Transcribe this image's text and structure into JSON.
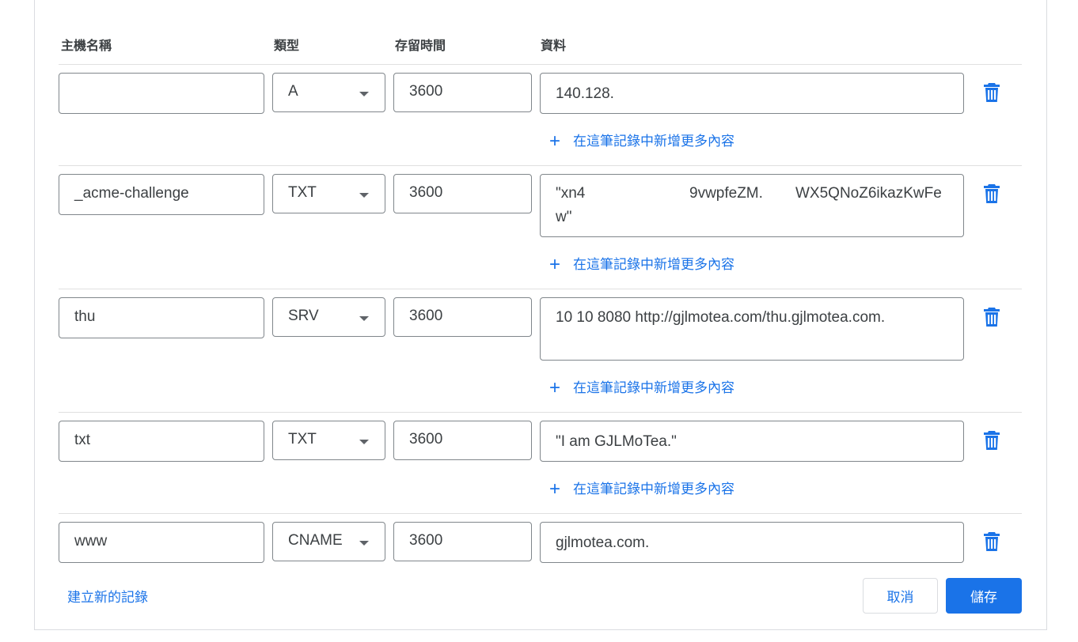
{
  "headers": {
    "hostname": "主機名稱",
    "type": "類型",
    "ttl": "存留時間",
    "data": "資料"
  },
  "records": [
    {
      "hostname": "",
      "type": "A",
      "ttl": "3600",
      "data": "140.128.",
      "add_more": "在這筆記錄中新增更多內容"
    },
    {
      "hostname": "_acme-challenge",
      "type": "TXT",
      "ttl": "3600",
      "data": "\"xn                        9vwpfeZM.          WX5QNoZ6ikazKwFe w\"",
      "data_parts": [
        "\"xn4",
        "9vwpfeZM.",
        "WX5QNoZ6ikazKwFe",
        "w\""
      ],
      "add_more": "在這筆記錄中新增更多內容"
    },
    {
      "hostname": "thu",
      "type": "SRV",
      "ttl": "3600",
      "data": "10 10 8080 http://gjlmotea.com/thu.gjlmotea.com.",
      "add_more": "在這筆記錄中新增更多內容"
    },
    {
      "hostname": "txt",
      "type": "TXT",
      "ttl": "3600",
      "data": "\"I am GJLMoTea.\"",
      "add_more": "在這筆記錄中新增更多內容"
    },
    {
      "hostname": "www",
      "type": "CNAME",
      "ttl": "3600",
      "data": "gjlmotea.com."
    }
  ],
  "footer": {
    "create_record": "建立新的記錄",
    "cancel": "取消",
    "save": "儲存"
  },
  "icons": {
    "delete": "trash-icon",
    "add": "plus-icon",
    "dropdown": "caret-down-icon"
  },
  "colors": {
    "accent": "#1a73e8",
    "border": "#80868b",
    "divider": "#e0e0e0"
  }
}
